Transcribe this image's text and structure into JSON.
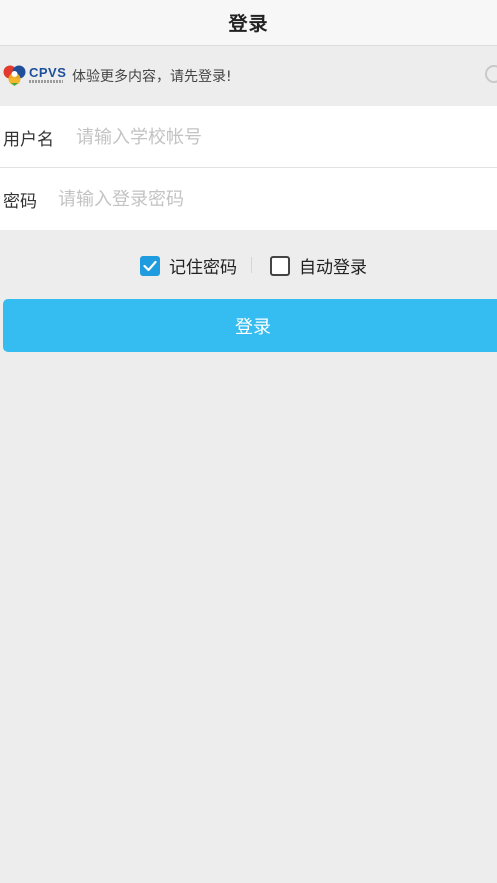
{
  "header": {
    "title": "登录"
  },
  "banner": {
    "logo_text": "CPVS",
    "message": "体验更多内容，请先登录!"
  },
  "form": {
    "username_label": "用户名",
    "username_placeholder": "请输入学校帐号",
    "password_label": "密码",
    "password_placeholder": "请输入登录密码"
  },
  "options": {
    "remember_label": "记住密码",
    "remember_checked": true,
    "auto_login_label": "自动登录",
    "auto_login_checked": false
  },
  "login_button": {
    "label": "登录"
  },
  "colors": {
    "accent": "#35bcf0",
    "checkbox_checked": "#1f9be0",
    "background": "#ededed"
  },
  "icons": [
    "cpvs-logo-icon",
    "check-icon",
    "refresh-icon"
  ]
}
